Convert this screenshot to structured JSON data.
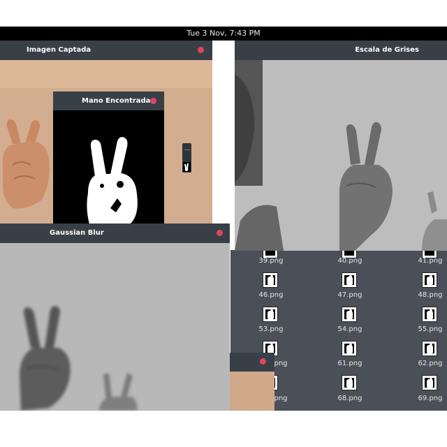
{
  "topbar": {
    "clock": "Tue  3 Nov,  7:43 PM"
  },
  "windows": {
    "captured": {
      "title": "Imagen Captada"
    },
    "found": {
      "title": "Mano Encontrada"
    },
    "gray": {
      "title": "Escala de Grises"
    },
    "blur": {
      "title": "Gaussian Blur"
    },
    "mini": {
      "label": "..."
    }
  },
  "files": {
    "rows": [
      [
        "39.png",
        "40.png",
        "41.png"
      ],
      [
        "46.png",
        "47.png",
        "48.png"
      ],
      [
        "53.png",
        "54.png",
        "55.png"
      ],
      [
        "png",
        "61.png",
        "62.png"
      ],
      [
        "png",
        "68.png",
        "69.png"
      ]
    ]
  },
  "colors": {
    "close_dot": "#e0465d",
    "titlebar": "#393f46",
    "file_panel": "#4a4f58"
  }
}
